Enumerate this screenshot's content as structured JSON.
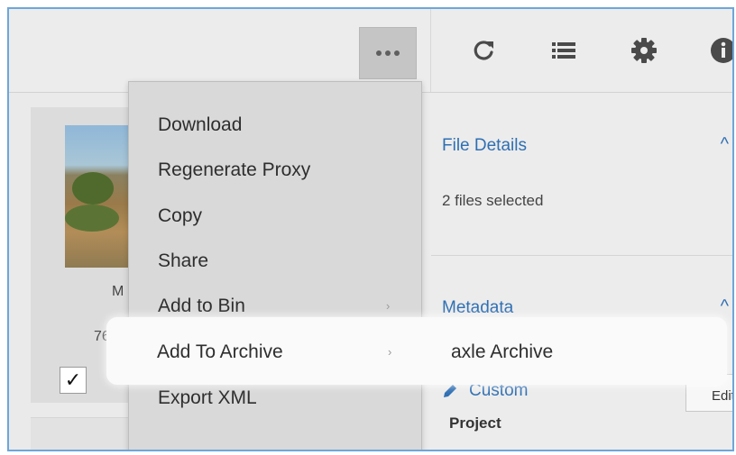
{
  "colors": {
    "accent": "#2f6fb3",
    "frame_border": "#6ea6da",
    "menu_bg": "#d9d9d9",
    "highlight_bg": "#fafafa"
  },
  "toolbar": {
    "more_button": "more-horizontal-icon",
    "icons": [
      "refresh-icon",
      "list-icon",
      "gear-icon",
      "info-icon"
    ]
  },
  "left_pane": {
    "card": {
      "name_fragment": "M",
      "size_fragment": "76.",
      "checkbox_mark": "✓"
    }
  },
  "menu": {
    "items": [
      {
        "label": "Download"
      },
      {
        "label": "Regenerate Proxy"
      },
      {
        "label": "Copy"
      },
      {
        "label": "Share"
      },
      {
        "label": "Add to Bin",
        "submenu_arrow": "›"
      },
      {
        "label": "Add To Archive",
        "submenu_arrow": "›"
      },
      {
        "label": "Export XML"
      }
    ]
  },
  "submenu": {
    "items": [
      {
        "label": "axle Archive"
      }
    ]
  },
  "right_pane": {
    "file_details": {
      "title": "File Details",
      "chevron": "^",
      "selection_text": "2 files selected"
    },
    "metadata": {
      "title": "Metadata",
      "chevron": "^",
      "custom_link": "Custom",
      "project_label": "Project",
      "edit_label": "Edit"
    }
  }
}
